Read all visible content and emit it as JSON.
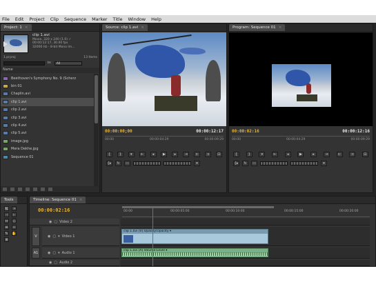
{
  "menu": [
    "File",
    "Edit",
    "Project",
    "Clip",
    "Sequence",
    "Marker",
    "Title",
    "Window",
    "Help"
  ],
  "project": {
    "tab": "Project: 1",
    "clip_name": "clip 1.avi",
    "clip_meta": [
      "Movie, 320 x 240 (1.0) ✓",
      "00:00:12:17, 30.00 fps",
      "32000 Hz - 8-bit Mono Im..."
    ],
    "location": "1.prproj",
    "items_count": "13 Items",
    "in_label": "In:",
    "in_value": "All",
    "column_name": "Name",
    "items": [
      {
        "name": "Beethoven's Symphony No. 9 (Scherz",
        "icon": "audio-icon"
      },
      {
        "name": "bin 01",
        "icon": "folder-icon"
      },
      {
        "name": "Chaplin.avi",
        "icon": "clip-icon"
      },
      {
        "name": "clip 1.avi",
        "icon": "clip-icon"
      },
      {
        "name": "clip 2.avi",
        "icon": "clip-icon"
      },
      {
        "name": "clip 3.avi",
        "icon": "clip-icon"
      },
      {
        "name": "clip 4.avi",
        "icon": "clip-icon"
      },
      {
        "name": "clip 5.avi",
        "icon": "clip-icon"
      },
      {
        "name": "image.jpg",
        "icon": "image-icon"
      },
      {
        "name": "Mera Dekhe.jpg",
        "icon": "image-icon"
      },
      {
        "name": "Sequence 01",
        "icon": "sequence-icon"
      }
    ]
  },
  "source": {
    "tab": "Source: clip 1.avi",
    "tc_in": "00:00:00;00",
    "tc_dur": "00:00:12:17",
    "ruler": [
      "00:00",
      "00:00:04:29",
      "00:00:09:29"
    ]
  },
  "program": {
    "tab": "Program: Sequence 01",
    "tc_in": "00:00:02:16",
    "tc_dur": "00:00:12:16",
    "ruler": [
      "00:00",
      "00:00:04:29",
      "00:00:09:29"
    ]
  },
  "tools_tab": "Tools",
  "timeline": {
    "tab": "Timeline: Sequence 01",
    "tc": "00:00:02:16",
    "ruler": [
      "00:00",
      "00:00:05:00",
      "00:00:10:00",
      "00:00:15:00",
      "00:00:20:00"
    ],
    "tracks": {
      "video2": "Video 2",
      "video1": "Video 1",
      "audio1": "Audio 1",
      "audio2": "Audio 2",
      "side_v": "V",
      "side_a": "A1"
    },
    "clip_video": "clip 1.avi [V]  Opacity:Opacity ▾",
    "clip_audio": "clip 1.avi [A]  Volume:Level ▾"
  }
}
